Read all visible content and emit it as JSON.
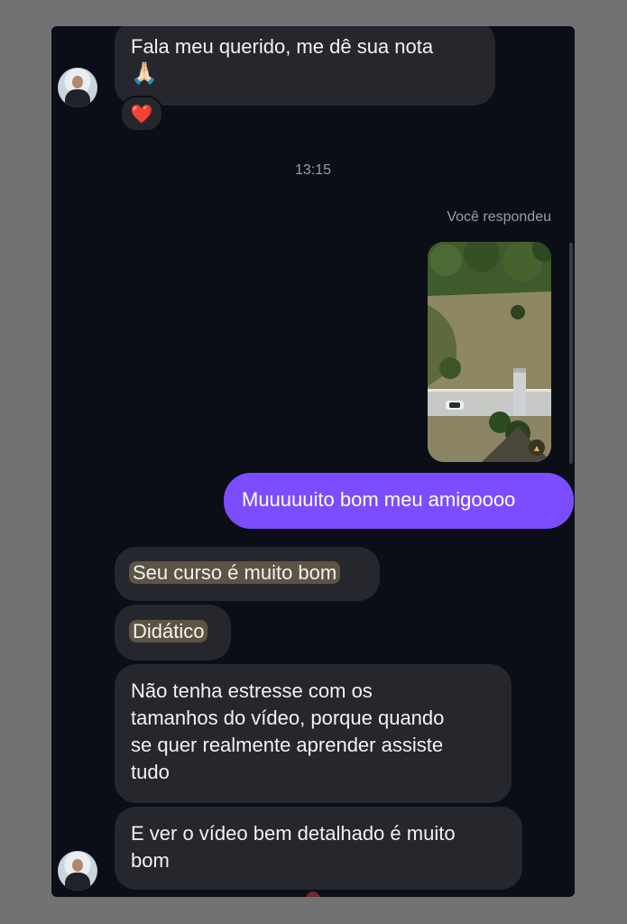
{
  "messages": {
    "m1": "Fala meu querido, me dê sua nota",
    "m1_emoji": "🙏🏻",
    "reaction": "❤️",
    "timestamp": "13:15",
    "reply_label": "Você respondeu",
    "sent": "Muuuuuito bom meu amigoooo",
    "m2": "Seu curso é muito bom",
    "m3": "Didático",
    "m4_lines": [
      "Não tenha estresse com os",
      "tamanhos do vídeo, porque quando",
      "se quer realmente aprender assiste",
      "tudo"
    ],
    "m5_lines": [
      "E ver o vídeo bem detalhado é muito",
      "bom"
    ]
  },
  "icons": {
    "avatar": "contact-avatar",
    "story_thumb": "aerial-photo-thumbnail"
  },
  "colors": {
    "background": "#0b0e17",
    "incoming_bubble": "#25272d",
    "outgoing_bubble": "#7c4dff",
    "highlight": "#5d5444"
  }
}
